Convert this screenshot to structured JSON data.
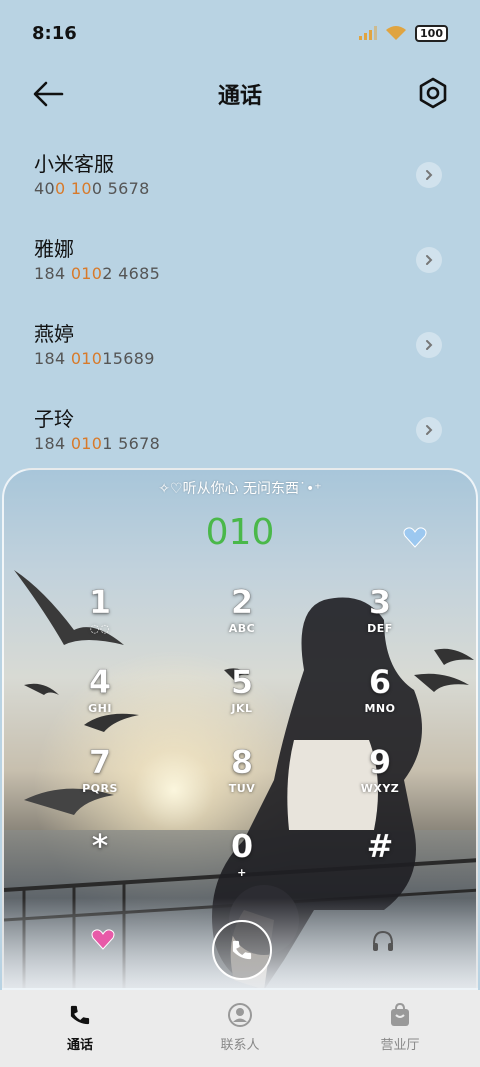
{
  "status_bar": {
    "time": "8:16",
    "battery": "100"
  },
  "header": {
    "title": "通话"
  },
  "contacts": [
    {
      "name": "小米客服",
      "number_parts": [
        "40",
        "0",
        " ",
        "10",
        "0 5678"
      ]
    },
    {
      "name": "雅娜",
      "number_parts": [
        "184 ",
        "010",
        "2 4685"
      ]
    },
    {
      "name": "燕婷",
      "number_parts": [
        "184 ",
        "010",
        "15689"
      ]
    },
    {
      "name": "子玲",
      "number_parts": [
        "184 ",
        "010",
        "1 5678"
      ]
    }
  ],
  "dialer": {
    "tagline": "✧♡听从你心 无问东西˙•⁺",
    "number": "010",
    "keys": [
      {
        "digit": "1",
        "letters": "◌◌"
      },
      {
        "digit": "2",
        "letters": "ABC"
      },
      {
        "digit": "3",
        "letters": "DEF"
      },
      {
        "digit": "4",
        "letters": "GHI"
      },
      {
        "digit": "5",
        "letters": "JKL"
      },
      {
        "digit": "6",
        "letters": "MNO"
      },
      {
        "digit": "7",
        "letters": "PQRS"
      },
      {
        "digit": "8",
        "letters": "TUV"
      },
      {
        "digit": "9",
        "letters": "WXYZ"
      },
      {
        "digit": "*",
        "letters": ""
      },
      {
        "digit": "0",
        "letters": "+"
      },
      {
        "digit": "#",
        "letters": ""
      }
    ]
  },
  "tabs": [
    {
      "label": "通话",
      "icon": "phone-icon",
      "active": true
    },
    {
      "label": "联系人",
      "icon": "person-icon",
      "active": false
    },
    {
      "label": "营业厅",
      "icon": "bag-icon",
      "active": false
    }
  ],
  "colors": {
    "highlight": "#d87a2a",
    "dial_number": "#4ab84a",
    "background": "#b9d3e3"
  }
}
